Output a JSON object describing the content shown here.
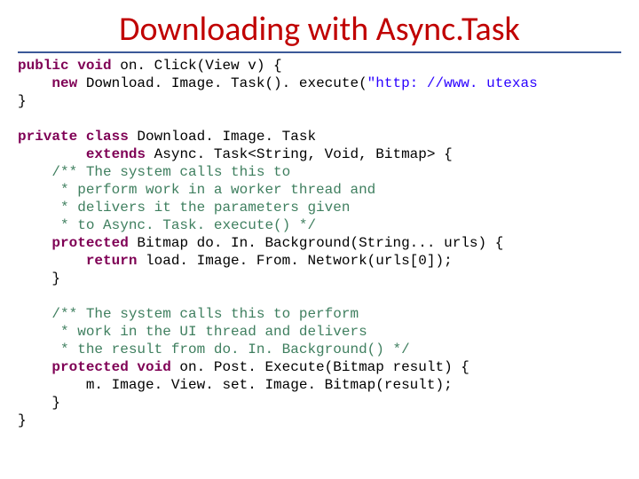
{
  "title": "Downloading with Async.Task",
  "code": {
    "l01a": "public void",
    "l01b": " on. Click(View v) {",
    "l02a": "    new",
    "l02b": " Download. Image. Task(). execute(",
    "l02c": "\"http: //www. utexas",
    "l03": "}",
    "l04": "",
    "l05a": "private class",
    "l05b": " Download. Image. Task",
    "l06a": "        extends",
    "l06b": " Async. Task<String, Void, Bitmap> {",
    "l07": "    /** The system calls this to",
    "l08": "     * perform work in a worker thread and",
    "l09": "     * delivers it the parameters given",
    "l10": "     * to Async. Task. execute() */",
    "l11a": "    protected",
    "l11b": " Bitmap do. In. Background(String... urls) {",
    "l12a": "        return",
    "l12b": " load. Image. From. Network(urls[0]);",
    "l13": "    }",
    "l14": "",
    "l15": "    /** The system calls this to perform",
    "l16": "     * work in the UI thread and delivers",
    "l17": "     * the result from do. In. Background() */",
    "l18a": "    protected void",
    "l18b": " on. Post. Execute(Bitmap result) {",
    "l19": "        m. Image. View. set. Image. Bitmap(result);",
    "l20": "    }",
    "l21": "}"
  }
}
